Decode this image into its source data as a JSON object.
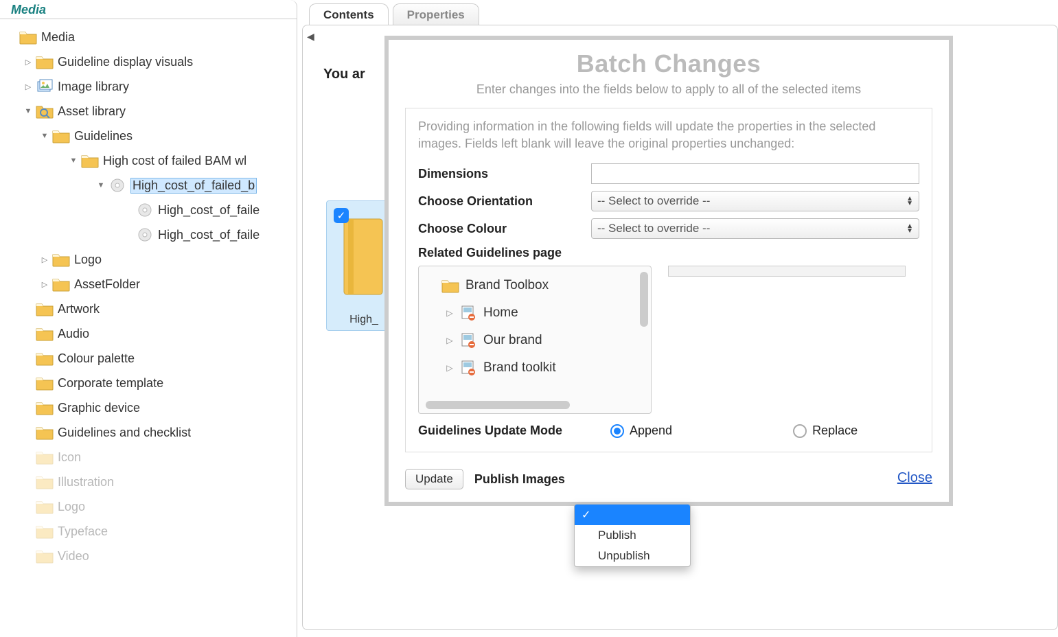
{
  "left_panel": {
    "tab": "Media",
    "root": "Media",
    "nodes": [
      {
        "id": "guideline-visuals",
        "label": "Guideline display visuals",
        "indent": 1,
        "arrow": "right",
        "icon": "folder"
      },
      {
        "id": "image-library",
        "label": "Image library",
        "indent": 1,
        "arrow": "right",
        "icon": "images"
      },
      {
        "id": "asset-library",
        "label": "Asset library",
        "indent": 1,
        "arrow": "down",
        "icon": "search-folder"
      },
      {
        "id": "guidelines",
        "label": "Guidelines",
        "indent": 2,
        "arrow": "down",
        "icon": "folder"
      },
      {
        "id": "high-cost-bam",
        "label": "High cost of failed BAM wl",
        "indent": 3,
        "arrow": "down",
        "icon": "folder"
      },
      {
        "id": "hcfb-1",
        "label": "High_cost_of_failed_b",
        "indent": 4,
        "arrow": "down",
        "icon": "disc",
        "selected": true
      },
      {
        "id": "hcfb-2",
        "label": "High_cost_of_faile",
        "indent": 5,
        "arrow": "none",
        "icon": "disc"
      },
      {
        "id": "hcfb-3",
        "label": "High_cost_of_faile",
        "indent": 5,
        "arrow": "none",
        "icon": "disc"
      },
      {
        "id": "logo",
        "label": "Logo",
        "indent": 2,
        "arrow": "right",
        "icon": "folder"
      },
      {
        "id": "assetfolder",
        "label": "AssetFolder",
        "indent": 2,
        "arrow": "right",
        "icon": "folder"
      },
      {
        "id": "artwork",
        "label": "Artwork",
        "indent": 1,
        "arrow": "none",
        "icon": "folder"
      },
      {
        "id": "audio",
        "label": "Audio",
        "indent": 1,
        "arrow": "none",
        "icon": "folder"
      },
      {
        "id": "colour-palette",
        "label": "Colour palette",
        "indent": 1,
        "arrow": "none",
        "icon": "folder"
      },
      {
        "id": "corp-template",
        "label": "Corporate template",
        "indent": 1,
        "arrow": "none",
        "icon": "folder"
      },
      {
        "id": "graphic-device",
        "label": "Graphic device",
        "indent": 1,
        "arrow": "none",
        "icon": "folder"
      },
      {
        "id": "guidelines-check",
        "label": "Guidelines and checklist",
        "indent": 1,
        "arrow": "none",
        "icon": "folder"
      },
      {
        "id": "icon",
        "label": "Icon",
        "indent": 1,
        "arrow": "none",
        "icon": "folder",
        "dim": true
      },
      {
        "id": "illustration",
        "label": "Illustration",
        "indent": 1,
        "arrow": "none",
        "icon": "folder",
        "dim": true
      },
      {
        "id": "logo-2",
        "label": "Logo",
        "indent": 1,
        "arrow": "none",
        "icon": "folder",
        "dim": true
      },
      {
        "id": "typeface",
        "label": "Typeface",
        "indent": 1,
        "arrow": "none",
        "icon": "folder",
        "dim": true
      },
      {
        "id": "video",
        "label": "Video",
        "indent": 1,
        "arrow": "none",
        "icon": "folder",
        "dim": true
      }
    ]
  },
  "main": {
    "tabs": {
      "contents": "Contents",
      "properties": "Properties"
    },
    "partial_heading": "You ar",
    "thumb_label": "High_"
  },
  "modal": {
    "title": "Batch Changes",
    "subtitle": "Enter changes into the fields below to apply to all of the selected items",
    "instructions": "Providing information in the following fields will update the properties in the selected images. Fields left blank will leave the original properties unchanged:",
    "labels": {
      "dimensions": "Dimensions",
      "orientation": "Choose Orientation",
      "colour": "Choose Colour",
      "related": "Related Guidelines page",
      "update_mode": "Guidelines Update Mode",
      "publish": "Publish Images"
    },
    "select_placeholder": "-- Select to override --",
    "related_tree": [
      {
        "label": "Brand Toolbox",
        "indent": 0,
        "arrow": "none",
        "icon": "folder"
      },
      {
        "label": "Home",
        "indent": 1,
        "arrow": "right",
        "icon": "page"
      },
      {
        "label": "Our brand",
        "indent": 1,
        "arrow": "right",
        "icon": "page"
      },
      {
        "label": "Brand toolkit",
        "indent": 1,
        "arrow": "right",
        "icon": "page"
      }
    ],
    "radios": {
      "append": "Append",
      "replace": "Replace",
      "selected": "append"
    },
    "buttons": {
      "update": "Update",
      "close": "Close"
    },
    "dropdown": {
      "blank": "",
      "publish": "Publish",
      "unpublish": "Unpublish"
    }
  }
}
